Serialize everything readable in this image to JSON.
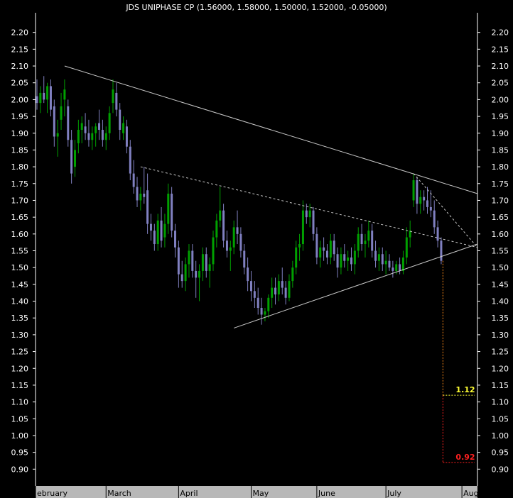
{
  "chart_data": {
    "type": "candlestick",
    "title": "JDS UNIPHASE CP (1.56000, 1.58000, 1.50000, 1.52000, -0.05000)",
    "ylim": [
      0.85,
      2.25
    ],
    "y_ticks": [
      0.9,
      0.95,
      1.0,
      1.05,
      1.1,
      1.15,
      1.2,
      1.25,
      1.3,
      1.35,
      1.4,
      1.45,
      1.5,
      1.55,
      1.6,
      1.65,
      1.7,
      1.75,
      1.8,
      1.85,
      1.9,
      1.95,
      2.0,
      2.05,
      2.1,
      2.15,
      2.2
    ],
    "y_tick_labels": [
      "0.90",
      "0.95",
      "1.00",
      "1.05",
      "1.10",
      "1.15",
      "1.20",
      "1.25",
      "1.30",
      "1.35",
      "1.40",
      "1.45",
      "1.50",
      "1.55",
      "1.60",
      "1.65",
      "1.70",
      "1.75",
      "1.80",
      "1.85",
      "1.90",
      "1.95",
      "2.00",
      "2.05",
      "2.10",
      "2.15",
      "2.20"
    ],
    "x_months": [
      {
        "label": "ebruary",
        "start_day": 0
      },
      {
        "label": "March",
        "start_day": 20
      },
      {
        "label": "April",
        "start_day": 41
      },
      {
        "label": "May",
        "start_day": 62
      },
      {
        "label": "June",
        "start_day": 81
      },
      {
        "label": "July",
        "start_day": 101
      },
      {
        "label": "August",
        "start_day": 123
      }
    ],
    "day_range": [
      0,
      127.5
    ],
    "colors": {
      "background": "#000000",
      "down_candle": "#8080c0",
      "up_candle": "#00a000",
      "trendline": "#c8c8c8",
      "projection": "#ff8c1a",
      "target1": "#ffff33",
      "target2": "#ff2020",
      "axis_bar": "#b8b8b8"
    },
    "candles": [
      {
        "day": 0,
        "o": 2.01,
        "h": 2.06,
        "l": 1.97,
        "c": 1.99
      },
      {
        "day": 1,
        "o": 1.99,
        "h": 2.04,
        "l": 1.96,
        "c": 2.02
      },
      {
        "day": 2,
        "o": 2.02,
        "h": 2.07,
        "l": 1.99,
        "c": 2.0
      },
      {
        "day": 3,
        "o": 2.0,
        "h": 2.05,
        "l": 1.96,
        "c": 2.04
      },
      {
        "day": 4,
        "o": 2.04,
        "h": 2.06,
        "l": 1.95,
        "c": 1.97
      },
      {
        "day": 5,
        "o": 1.98,
        "h": 2.0,
        "l": 1.86,
        "c": 1.89
      },
      {
        "day": 6,
        "o": 1.89,
        "h": 1.94,
        "l": 1.83,
        "c": 1.9
      },
      {
        "day": 7,
        "o": 1.94,
        "h": 2.02,
        "l": 1.91,
        "c": 1.98
      },
      {
        "day": 8,
        "o": 2.0,
        "h": 2.06,
        "l": 1.95,
        "c": 2.03
      },
      {
        "day": 9,
        "o": 1.98,
        "h": 2.0,
        "l": 1.86,
        "c": 1.88
      },
      {
        "day": 10,
        "o": 1.88,
        "h": 1.91,
        "l": 1.75,
        "c": 1.78
      },
      {
        "day": 11,
        "o": 1.8,
        "h": 1.88,
        "l": 1.77,
        "c": 1.85
      },
      {
        "day": 12,
        "o": 1.87,
        "h": 1.94,
        "l": 1.84,
        "c": 1.91
      },
      {
        "day": 13,
        "o": 1.91,
        "h": 1.95,
        "l": 1.87,
        "c": 1.93
      },
      {
        "day": 14,
        "o": 1.92,
        "h": 1.96,
        "l": 1.88,
        "c": 1.9
      },
      {
        "day": 15,
        "o": 1.9,
        "h": 1.94,
        "l": 1.86,
        "c": 1.88
      },
      {
        "day": 16,
        "o": 1.88,
        "h": 1.92,
        "l": 1.85,
        "c": 1.9
      },
      {
        "day": 17,
        "o": 1.9,
        "h": 1.93,
        "l": 1.86,
        "c": 1.92
      },
      {
        "day": 18,
        "o": 1.93,
        "h": 1.97,
        "l": 1.88,
        "c": 1.91
      },
      {
        "day": 19,
        "o": 1.91,
        "h": 1.94,
        "l": 1.86,
        "c": 1.88
      },
      {
        "day": 20,
        "o": 1.88,
        "h": 1.92,
        "l": 1.85,
        "c": 1.9
      },
      {
        "day": 21,
        "o": 1.9,
        "h": 1.98,
        "l": 1.88,
        "c": 1.96
      },
      {
        "day": 22,
        "o": 1.99,
        "h": 2.06,
        "l": 1.96,
        "c": 2.03
      },
      {
        "day": 23,
        "o": 2.02,
        "h": 2.05,
        "l": 1.95,
        "c": 1.97
      },
      {
        "day": 24,
        "o": 1.97,
        "h": 1.99,
        "l": 1.88,
        "c": 1.91
      },
      {
        "day": 25,
        "o": 1.9,
        "h": 1.95,
        "l": 1.88,
        "c": 1.93
      },
      {
        "day": 26,
        "o": 1.92,
        "h": 1.94,
        "l": 1.84,
        "c": 1.86
      },
      {
        "day": 27,
        "o": 1.86,
        "h": 1.88,
        "l": 1.76,
        "c": 1.78
      },
      {
        "day": 28,
        "o": 1.78,
        "h": 1.82,
        "l": 1.72,
        "c": 1.74
      },
      {
        "day": 29,
        "o": 1.74,
        "h": 1.77,
        "l": 1.68,
        "c": 1.7
      },
      {
        "day": 30,
        "o": 1.7,
        "h": 1.74,
        "l": 1.67,
        "c": 1.72
      },
      {
        "day": 31,
        "o": 1.72,
        "h": 1.8,
        "l": 1.69,
        "c": 1.71
      },
      {
        "day": 32,
        "o": 1.73,
        "h": 1.78,
        "l": 1.6,
        "c": 1.63
      },
      {
        "day": 33,
        "o": 1.63,
        "h": 1.66,
        "l": 1.58,
        "c": 1.61
      },
      {
        "day": 34,
        "o": 1.61,
        "h": 1.63,
        "l": 1.55,
        "c": 1.57
      },
      {
        "day": 35,
        "o": 1.57,
        "h": 1.66,
        "l": 1.55,
        "c": 1.64
      },
      {
        "day": 36,
        "o": 1.64,
        "h": 1.68,
        "l": 1.56,
        "c": 1.58
      },
      {
        "day": 37,
        "o": 1.59,
        "h": 1.66,
        "l": 1.56,
        "c": 1.63
      },
      {
        "day": 38,
        "o": 1.63,
        "h": 1.75,
        "l": 1.6,
        "c": 1.72
      },
      {
        "day": 39,
        "o": 1.72,
        "h": 1.74,
        "l": 1.59,
        "c": 1.61
      },
      {
        "day": 40,
        "o": 1.61,
        "h": 1.63,
        "l": 1.53,
        "c": 1.56
      },
      {
        "day": 41,
        "o": 1.56,
        "h": 1.58,
        "l": 1.44,
        "c": 1.48
      },
      {
        "day": 42,
        "o": 1.48,
        "h": 1.52,
        "l": 1.44,
        "c": 1.46
      },
      {
        "day": 43,
        "o": 1.46,
        "h": 1.53,
        "l": 1.43,
        "c": 1.51
      },
      {
        "day": 44,
        "o": 1.51,
        "h": 1.57,
        "l": 1.47,
        "c": 1.55
      },
      {
        "day": 45,
        "o": 1.55,
        "h": 1.57,
        "l": 1.47,
        "c": 1.49
      },
      {
        "day": 46,
        "o": 1.49,
        "h": 1.52,
        "l": 1.41,
        "c": 1.47
      },
      {
        "day": 47,
        "o": 1.47,
        "h": 1.51,
        "l": 1.4,
        "c": 1.49
      },
      {
        "day": 48,
        "o": 1.49,
        "h": 1.56,
        "l": 1.46,
        "c": 1.54
      },
      {
        "day": 49,
        "o": 1.54,
        "h": 1.56,
        "l": 1.47,
        "c": 1.49
      },
      {
        "day": 50,
        "o": 1.49,
        "h": 1.53,
        "l": 1.44,
        "c": 1.51
      },
      {
        "day": 51,
        "o": 1.51,
        "h": 1.61,
        "l": 1.49,
        "c": 1.59
      },
      {
        "day": 52,
        "o": 1.59,
        "h": 1.66,
        "l": 1.56,
        "c": 1.64
      },
      {
        "day": 53,
        "o": 1.64,
        "h": 1.74,
        "l": 1.62,
        "c": 1.67
      },
      {
        "day": 54,
        "o": 1.67,
        "h": 1.69,
        "l": 1.56,
        "c": 1.58
      },
      {
        "day": 55,
        "o": 1.58,
        "h": 1.61,
        "l": 1.53,
        "c": 1.55
      },
      {
        "day": 56,
        "o": 1.55,
        "h": 1.58,
        "l": 1.49,
        "c": 1.56
      },
      {
        "day": 57,
        "o": 1.56,
        "h": 1.64,
        "l": 1.54,
        "c": 1.62
      },
      {
        "day": 58,
        "o": 1.62,
        "h": 1.67,
        "l": 1.57,
        "c": 1.6
      },
      {
        "day": 59,
        "o": 1.6,
        "h": 1.62,
        "l": 1.53,
        "c": 1.55
      },
      {
        "day": 60,
        "o": 1.55,
        "h": 1.57,
        "l": 1.48,
        "c": 1.5
      },
      {
        "day": 61,
        "o": 1.5,
        "h": 1.53,
        "l": 1.43,
        "c": 1.46
      },
      {
        "day": 62,
        "o": 1.46,
        "h": 1.49,
        "l": 1.4,
        "c": 1.43
      },
      {
        "day": 63,
        "o": 1.43,
        "h": 1.46,
        "l": 1.38,
        "c": 1.41
      },
      {
        "day": 64,
        "o": 1.41,
        "h": 1.44,
        "l": 1.36,
        "c": 1.38
      },
      {
        "day": 65,
        "o": 1.38,
        "h": 1.41,
        "l": 1.33,
        "c": 1.36
      },
      {
        "day": 66,
        "o": 1.36,
        "h": 1.38,
        "l": 1.34,
        "c": 1.37
      },
      {
        "day": 67,
        "o": 1.37,
        "h": 1.42,
        "l": 1.35,
        "c": 1.41
      },
      {
        "day": 68,
        "o": 1.41,
        "h": 1.47,
        "l": 1.38,
        "c": 1.44
      },
      {
        "day": 69,
        "o": 1.44,
        "h": 1.47,
        "l": 1.39,
        "c": 1.42
      },
      {
        "day": 70,
        "o": 1.42,
        "h": 1.48,
        "l": 1.4,
        "c": 1.46
      },
      {
        "day": 71,
        "o": 1.46,
        "h": 1.5,
        "l": 1.42,
        "c": 1.44
      },
      {
        "day": 72,
        "o": 1.44,
        "h": 1.46,
        "l": 1.39,
        "c": 1.41
      },
      {
        "day": 73,
        "o": 1.41,
        "h": 1.48,
        "l": 1.4,
        "c": 1.46
      },
      {
        "day": 74,
        "o": 1.46,
        "h": 1.52,
        "l": 1.44,
        "c": 1.5
      },
      {
        "day": 75,
        "o": 1.5,
        "h": 1.58,
        "l": 1.48,
        "c": 1.56
      },
      {
        "day": 76,
        "o": 1.56,
        "h": 1.6,
        "l": 1.52,
        "c": 1.57
      },
      {
        "day": 77,
        "o": 1.57,
        "h": 1.7,
        "l": 1.55,
        "c": 1.67
      },
      {
        "day": 78,
        "o": 1.67,
        "h": 1.69,
        "l": 1.63,
        "c": 1.65
      },
      {
        "day": 79,
        "o": 1.65,
        "h": 1.69,
        "l": 1.62,
        "c": 1.67
      },
      {
        "day": 80,
        "o": 1.67,
        "h": 1.68,
        "l": 1.58,
        "c": 1.6
      },
      {
        "day": 81,
        "o": 1.6,
        "h": 1.62,
        "l": 1.51,
        "c": 1.53
      },
      {
        "day": 82,
        "o": 1.53,
        "h": 1.58,
        "l": 1.5,
        "c": 1.56
      },
      {
        "day": 83,
        "o": 1.56,
        "h": 1.59,
        "l": 1.52,
        "c": 1.55
      },
      {
        "day": 84,
        "o": 1.55,
        "h": 1.57,
        "l": 1.51,
        "c": 1.53
      },
      {
        "day": 85,
        "o": 1.53,
        "h": 1.6,
        "l": 1.51,
        "c": 1.58
      },
      {
        "day": 86,
        "o": 1.58,
        "h": 1.6,
        "l": 1.52,
        "c": 1.54
      },
      {
        "day": 87,
        "o": 1.54,
        "h": 1.56,
        "l": 1.47,
        "c": 1.5
      },
      {
        "day": 88,
        "o": 1.5,
        "h": 1.56,
        "l": 1.48,
        "c": 1.54
      },
      {
        "day": 89,
        "o": 1.54,
        "h": 1.57,
        "l": 1.5,
        "c": 1.52
      },
      {
        "day": 90,
        "o": 1.52,
        "h": 1.55,
        "l": 1.49,
        "c": 1.53
      },
      {
        "day": 91,
        "o": 1.53,
        "h": 1.56,
        "l": 1.49,
        "c": 1.51
      },
      {
        "day": 92,
        "o": 1.51,
        "h": 1.57,
        "l": 1.48,
        "c": 1.55
      },
      {
        "day": 93,
        "o": 1.55,
        "h": 1.62,
        "l": 1.53,
        "c": 1.6
      },
      {
        "day": 94,
        "o": 1.6,
        "h": 1.63,
        "l": 1.55,
        "c": 1.57
      },
      {
        "day": 95,
        "o": 1.57,
        "h": 1.6,
        "l": 1.53,
        "c": 1.58
      },
      {
        "day": 96,
        "o": 1.58,
        "h": 1.64,
        "l": 1.56,
        "c": 1.61
      },
      {
        "day": 97,
        "o": 1.61,
        "h": 1.63,
        "l": 1.53,
        "c": 1.55
      },
      {
        "day": 98,
        "o": 1.55,
        "h": 1.58,
        "l": 1.5,
        "c": 1.52
      },
      {
        "day": 99,
        "o": 1.52,
        "h": 1.56,
        "l": 1.49,
        "c": 1.54
      },
      {
        "day": 100,
        "o": 1.54,
        "h": 1.56,
        "l": 1.49,
        "c": 1.51
      },
      {
        "day": 101,
        "o": 1.51,
        "h": 1.55,
        "l": 1.48,
        "c": 1.52
      },
      {
        "day": 102,
        "o": 1.52,
        "h": 1.54,
        "l": 1.49,
        "c": 1.5
      },
      {
        "day": 103,
        "o": 1.5,
        "h": 1.52,
        "l": 1.47,
        "c": 1.49
      },
      {
        "day": 104,
        "o": 1.49,
        "h": 1.52,
        "l": 1.48,
        "c": 1.51
      },
      {
        "day": 105,
        "o": 1.51,
        "h": 1.53,
        "l": 1.48,
        "c": 1.49
      },
      {
        "day": 106,
        "o": 1.49,
        "h": 1.55,
        "l": 1.48,
        "c": 1.53
      },
      {
        "day": 107,
        "o": 1.53,
        "h": 1.62,
        "l": 1.51,
        "c": 1.59
      },
      {
        "day": 108,
        "o": 1.59,
        "h": 1.64,
        "l": 1.56,
        "c": 1.61
      },
      {
        "day": 109,
        "o": 1.7,
        "h": 1.78,
        "l": 1.68,
        "c": 1.76
      },
      {
        "day": 110,
        "o": 1.76,
        "h": 1.77,
        "l": 1.66,
        "c": 1.69
      },
      {
        "day": 111,
        "o": 1.69,
        "h": 1.73,
        "l": 1.66,
        "c": 1.71
      },
      {
        "day": 112,
        "o": 1.71,
        "h": 1.73,
        "l": 1.67,
        "c": 1.7
      },
      {
        "day": 113,
        "o": 1.7,
        "h": 1.74,
        "l": 1.66,
        "c": 1.68
      },
      {
        "day": 114,
        "o": 1.68,
        "h": 1.73,
        "l": 1.65,
        "c": 1.67
      },
      {
        "day": 115,
        "o": 1.67,
        "h": 1.7,
        "l": 1.6,
        "c": 1.62
      },
      {
        "day": 116,
        "o": 1.62,
        "h": 1.64,
        "l": 1.56,
        "c": 1.58
      },
      {
        "day": 117,
        "o": 1.58,
        "h": 1.59,
        "l": 1.51,
        "c": 1.52
      }
    ],
    "trendlines": [
      {
        "kind": "solid",
        "from": [
          8,
          2.1
        ],
        "to": [
          127.5,
          1.72
        ]
      },
      {
        "kind": "dashed",
        "from": [
          30,
          1.8
        ],
        "to": [
          127.5,
          1.56
        ]
      },
      {
        "kind": "solid",
        "from": [
          57,
          1.32
        ],
        "to": [
          127.5,
          1.57
        ]
      },
      {
        "kind": "dashed",
        "from": [
          109,
          1.78
        ],
        "to": [
          127.5,
          1.56
        ]
      }
    ],
    "projection": {
      "day": 117.5,
      "from": 1.52,
      "to": 0.92
    },
    "targets": [
      {
        "label": "1.12",
        "value": 1.12,
        "color_key": "target1"
      },
      {
        "label": "0.92",
        "value": 0.92,
        "color_key": "target2"
      }
    ]
  }
}
